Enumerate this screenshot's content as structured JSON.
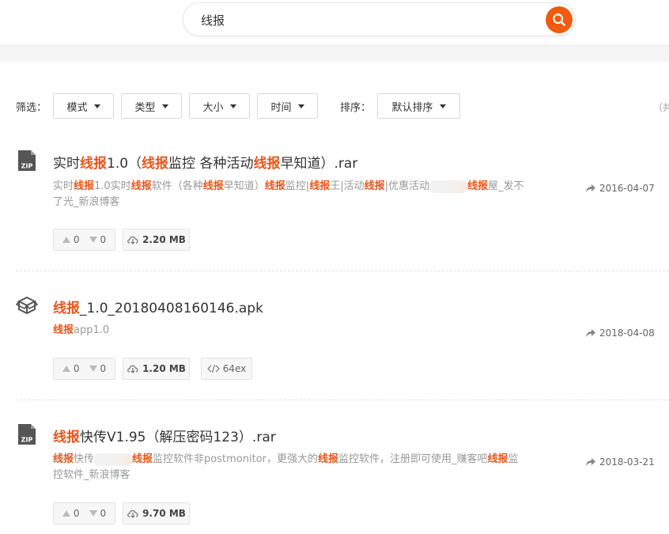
{
  "search": {
    "value": "线报"
  },
  "filters": {
    "label": "筛选：",
    "dropdowns": [
      "模式",
      "类型",
      "大小",
      "时间"
    ],
    "sort_label": "排序：",
    "sort_value": "默认排序",
    "total_partial": "（共"
  },
  "results": [
    {
      "icon": "zip-file-icon",
      "title": [
        {
          "t": "实时"
        },
        {
          "t": "线报",
          "hl": true
        },
        {
          "t": "1.0（"
        },
        {
          "t": "线报",
          "hl": true
        },
        {
          "t": "监控 各种活动"
        },
        {
          "t": "线报",
          "hl": true
        },
        {
          "t": "早知道）.rar"
        }
      ],
      "desc": [
        {
          "t": "实时"
        },
        {
          "t": "线报",
          "hl": true
        },
        {
          "t": "1.0实时"
        },
        {
          "t": "线报",
          "hl": true
        },
        {
          "t": "软件（各种"
        },
        {
          "t": "线报",
          "hl": true
        },
        {
          "t": "早知道）"
        },
        {
          "t": "线报",
          "hl": true
        },
        {
          "t": "监控|"
        },
        {
          "t": "线报",
          "hl": true
        },
        {
          "t": "王|活动"
        },
        {
          "t": "线报",
          "hl": true
        },
        {
          "t": "|优惠活动"
        },
        {
          "blur": true
        },
        {
          "t": "线报",
          "hl": true
        },
        {
          "t": "屋_发不了光_新浪博客"
        }
      ],
      "date": "2016-04-07",
      "up": "0",
      "down": "0",
      "size": "2.20 MB"
    },
    {
      "icon": "package-icon",
      "title": [
        {
          "t": "线报",
          "hl": true
        },
        {
          "t": "_1.0_20180408160146.apk"
        }
      ],
      "desc": [
        {
          "t": "线报",
          "hl": true
        },
        {
          "t": "app1.0"
        }
      ],
      "date": "2018-04-08",
      "up": "0",
      "down": "0",
      "size": "1.20 MB",
      "code": "64ex"
    },
    {
      "icon": "zip-file-icon",
      "title": [
        {
          "t": "线报",
          "hl": true
        },
        {
          "t": "快传V1.95（解压密码123）.rar"
        }
      ],
      "desc": [
        {
          "t": "线报",
          "hl": true
        },
        {
          "t": "快传"
        },
        {
          "blur": true
        },
        {
          "t": "线报",
          "hl": true
        },
        {
          "t": "监控软件非postmonitor，更强大的"
        },
        {
          "t": "线报",
          "hl": true
        },
        {
          "t": "监控软件，注册即可使用_赚客吧"
        },
        {
          "t": "线报",
          "hl": true
        },
        {
          "t": "监控软件_新浪博客"
        }
      ],
      "date": "2018-03-21",
      "up": "0",
      "down": "0",
      "size": "9.70 MB"
    }
  ],
  "colors": {
    "accent": "#f25a0f",
    "highlight": "#e8561c"
  }
}
